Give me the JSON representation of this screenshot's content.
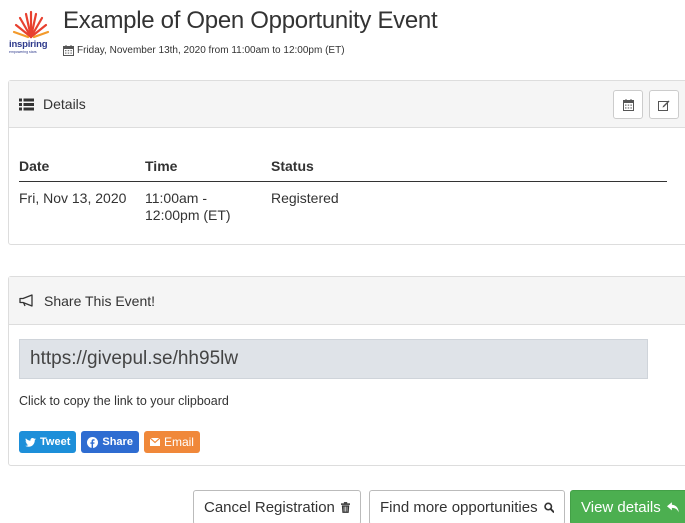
{
  "header": {
    "logo_text": "inspiring",
    "logo_tagline": "empowering stars",
    "title": "Example of Open Opportunity Event",
    "date_line": "Friday, November 13th, 2020 from 11:00am to 12:00pm (ET)",
    "date_icon": "calendar-icon"
  },
  "details_panel": {
    "heading": "Details",
    "heading_icon": "list-icon",
    "buttons": [
      {
        "icon": "calendar-icon"
      },
      {
        "icon": "edit-icon"
      }
    ],
    "columns": [
      "Date",
      "Time",
      "Status"
    ],
    "rows": [
      {
        "date": "Fri, Nov 13, 2020",
        "time": "11:00am - 12:00pm (ET)",
        "status": "Registered"
      }
    ]
  },
  "share_panel": {
    "heading": "Share This Event!",
    "heading_icon": "bullhorn-icon",
    "link": "https://givepul.se/hh95lw",
    "hint": "Click to copy the link to your clipboard",
    "buttons": {
      "tweet": "Tweet",
      "share": "Share",
      "email": "Email"
    }
  },
  "actions": {
    "cancel": "Cancel Registration",
    "find": "Find more opportunities",
    "view": "View details"
  },
  "colors": {
    "primary_green": "#4caf50",
    "twitter_blue": "#1d8fd9",
    "facebook_blue": "#2e6cd1",
    "email_orange": "#f0883a",
    "panel_heading_bg": "#f5f5f5",
    "link_box_bg": "#dfe3e8"
  }
}
